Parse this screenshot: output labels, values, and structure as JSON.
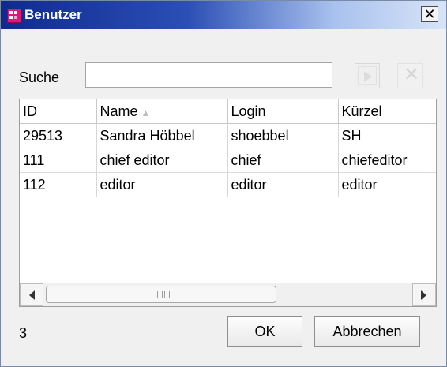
{
  "window": {
    "title": "Benutzer",
    "close_glyph": "✕"
  },
  "search": {
    "label": "Suche",
    "value": "",
    "placeholder": ""
  },
  "table": {
    "columns": [
      "ID",
      "Name",
      "Login",
      "Kürzel"
    ],
    "sort_indicator": "▲",
    "rows": [
      [
        "29513",
        "Sandra Höbbel",
        "shoebbel",
        "SH"
      ],
      [
        "111",
        "chief editor",
        "chief",
        "chiefeditor"
      ],
      [
        "112",
        "editor",
        "editor",
        "editor"
      ]
    ]
  },
  "footer": {
    "count": "3",
    "ok_label": "OK",
    "cancel_label": "Abbrechen"
  },
  "icons": {
    "app": "users-app-icon",
    "go": "play-icon",
    "clear": "clear-icon"
  },
  "colors": {
    "title_start": "#0f2a8f",
    "title_end": "#d7e4f7",
    "app_icon": "#d91a7a"
  }
}
